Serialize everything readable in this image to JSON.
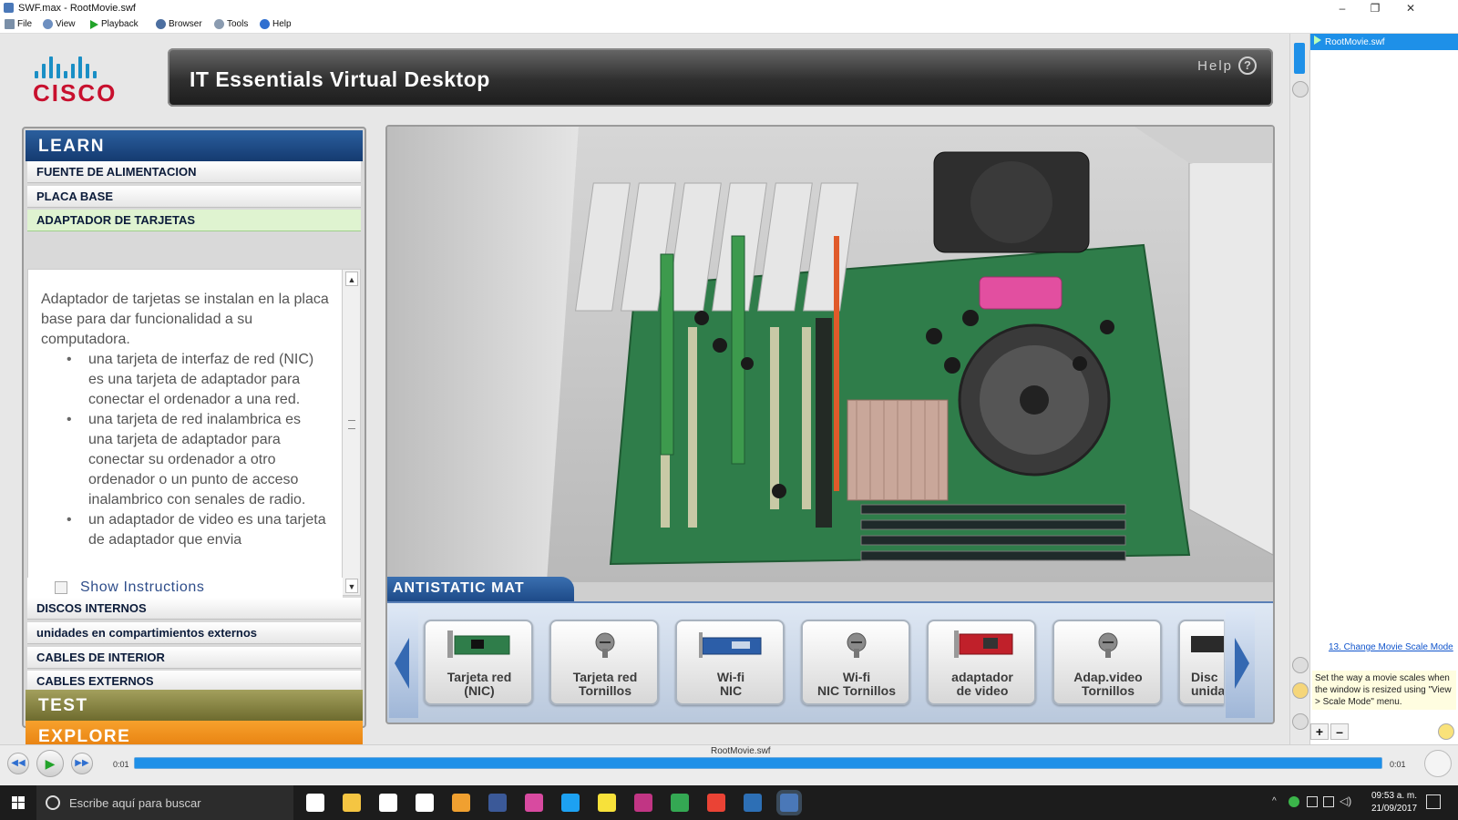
{
  "window": {
    "title": "SWF.max - RootMovie.swf",
    "controls": [
      "–",
      "❐",
      "✕"
    ]
  },
  "menu": [
    {
      "label": "File",
      "icon": "file-icon"
    },
    {
      "label": "View",
      "icon": "view-icon"
    },
    {
      "label": "Playback",
      "icon": "play-icon"
    },
    {
      "label": "Browser",
      "icon": "browser-icon"
    },
    {
      "label": "Tools",
      "icon": "gear-icon"
    },
    {
      "label": "Help",
      "icon": "help-icon"
    }
  ],
  "header": {
    "logo_text": "CISCO",
    "title": "IT Essentials Virtual Desktop",
    "help_label": "Help",
    "help_icon_glyph": "?"
  },
  "learn": {
    "heading": "LEARN",
    "items_top": [
      "FUENTE DE ALIMENTACION",
      "PLACA BASE",
      "ADAPTADOR DE TARJETAS"
    ],
    "active_index": 2,
    "description": {
      "intro": "Adaptador de tarjetas se instalan en la placa base para dar funcionalidad a su computadora.",
      "bullets": [
        "una tarjeta de interfaz de red (NIC) es una tarjeta de adaptador para conectar el ordenador a una red.",
        "una tarjeta de red inalambrica es una tarjeta de adaptador para conectar su ordenador a otro ordenador o un punto de acceso inalambrico con senales de radio.",
        "un adaptador de video es una tarjeta de adaptador que envia"
      ]
    },
    "show_instructions": "Show Instructions",
    "items_bottom": [
      "DISCOS INTERNOS",
      "unidades en compartimientos externos",
      "CABLES DE INTERIOR",
      "CABLES EXTERNOS"
    ]
  },
  "test_heading": "TEST",
  "explore_heading": "EXPLORE",
  "antistatic": {
    "label": "ANTISTATIC MAT",
    "tiles": [
      {
        "label": "Tarjeta red\n(NIC)",
        "kind": "card"
      },
      {
        "label": "Tarjeta red\nTornillos",
        "kind": "screw"
      },
      {
        "label": "Wi-fi\nNIC",
        "kind": "wifi"
      },
      {
        "label": "Wi-fi\nNIC Tornillos",
        "kind": "screw"
      },
      {
        "label": "adaptador\nde video",
        "kind": "video"
      },
      {
        "label": "Adap.video\nTornillos",
        "kind": "screw"
      },
      {
        "label": "Disc\nunida",
        "kind": "disk"
      }
    ]
  },
  "right_panel": {
    "tab": "RootMovie.swf",
    "tip_link": "13. Change Movie Scale Mode",
    "tip_text": "Set the way a movie scales when the window is resized using \"View > Scale Mode\" menu.",
    "zoom_in": "+",
    "zoom_out": "–"
  },
  "playback": {
    "movie": "RootMovie.swf",
    "time_left": "0:01",
    "time_right": "0:01",
    "progress": 1.0
  },
  "taskbar": {
    "search_placeholder": "Escribe aquí para buscar",
    "time": "09:53 a. m.",
    "date": "21/09/2017",
    "apps": [
      {
        "name": "task-view-icon",
        "color": "#ffffff"
      },
      {
        "name": "file-explorer-icon",
        "color": "#f5c542"
      },
      {
        "name": "store-icon",
        "color": "#ffffff"
      },
      {
        "name": "mail-icon",
        "color": "#ffffff"
      },
      {
        "name": "media-player-icon",
        "color": "#f0a030"
      },
      {
        "name": "facebook-icon",
        "color": "#3b5998"
      },
      {
        "name": "picasa-icon",
        "color": "#d84aa0"
      },
      {
        "name": "twitter-icon",
        "color": "#1da1f2"
      },
      {
        "name": "sticky-notes-icon",
        "color": "#f7e13a"
      },
      {
        "name": "instagram-icon",
        "color": "#c13584"
      },
      {
        "name": "chrome-icon",
        "color": "#34a853"
      },
      {
        "name": "chrome-alt-icon",
        "color": "#ea4335"
      },
      {
        "name": "terminal-icon",
        "color": "#2d6fb5"
      },
      {
        "name": "swf-max-icon",
        "color": "#4a78b8"
      }
    ]
  },
  "colors": {
    "learn": "#1f4d8a",
    "test": "#8c8946",
    "explore": "#f08f1a",
    "accent": "#1e90e8"
  }
}
